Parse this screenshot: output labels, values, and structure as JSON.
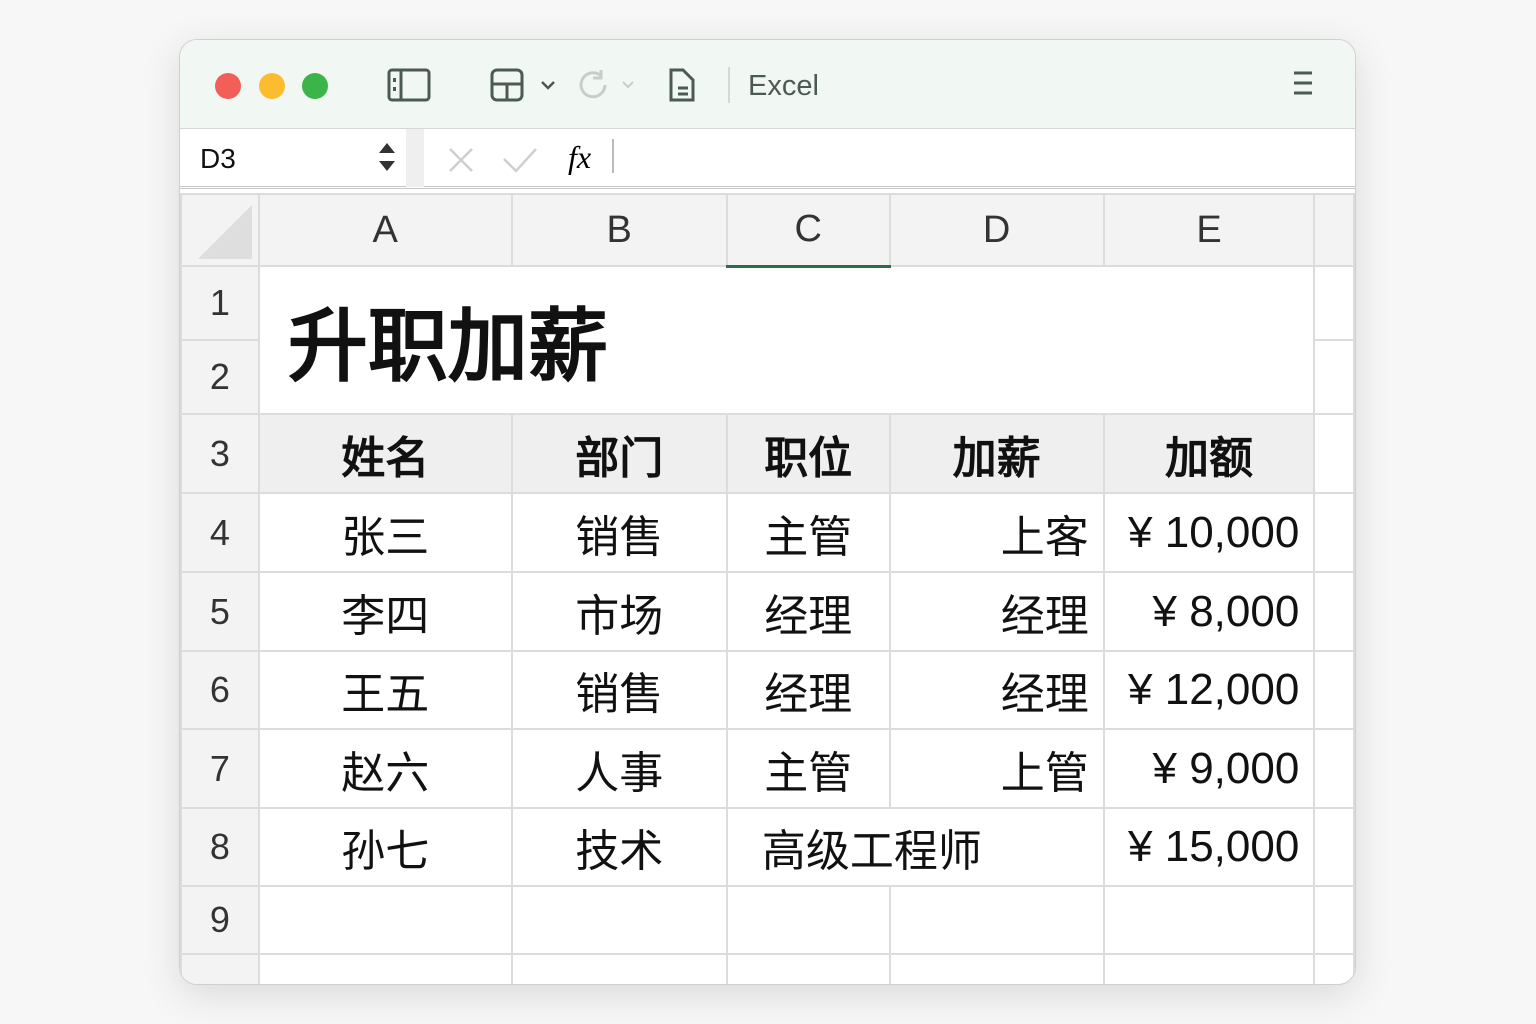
{
  "window": {
    "app_name": "Excel"
  },
  "formula_bar": {
    "name_box": "D3",
    "fx_label": "fx",
    "content": ""
  },
  "columns": [
    "A",
    "B",
    "C",
    "D",
    "E"
  ],
  "selected_column": "C",
  "rows": [
    "1",
    "2",
    "3",
    "4",
    "5",
    "6",
    "7",
    "8",
    "9"
  ],
  "title": "升职加薪",
  "headers": [
    "姓名",
    "部门",
    "职位",
    "加薪",
    "加额"
  ],
  "data": [
    [
      "张三",
      "销售",
      "主管",
      "上客",
      "¥ 10,000"
    ],
    [
      "李四",
      "市场",
      "经理",
      "经理",
      "¥ 8,000"
    ],
    [
      "王五",
      "销售",
      "经理",
      "经理",
      "¥ 12,000"
    ],
    [
      "赵六",
      "人事",
      "主管",
      "上管",
      "¥ 9,000"
    ]
  ],
  "row8": {
    "name": "孙七",
    "dept": "技术",
    "position": "高级工程师",
    "amount": "¥ 15,000"
  },
  "colors": {
    "accent": "#2e6b4a",
    "close": "#f25f58",
    "minimize": "#fbbc2e",
    "zoom": "#3bb54a"
  }
}
